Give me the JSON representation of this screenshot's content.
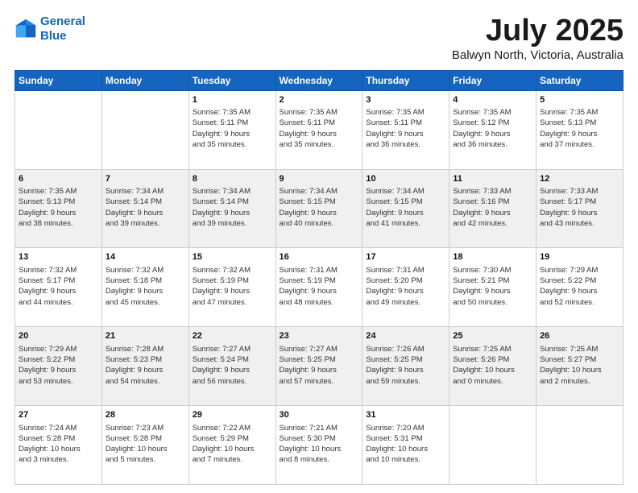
{
  "header": {
    "logo_line1": "General",
    "logo_line2": "Blue",
    "main_title": "July 2025",
    "subtitle": "Balwyn North, Victoria, Australia"
  },
  "calendar": {
    "days_of_week": [
      "Sunday",
      "Monday",
      "Tuesday",
      "Wednesday",
      "Thursday",
      "Friday",
      "Saturday"
    ],
    "weeks": [
      [
        {
          "day": "",
          "content": ""
        },
        {
          "day": "",
          "content": ""
        },
        {
          "day": "1",
          "content": "Sunrise: 7:35 AM\nSunset: 5:11 PM\nDaylight: 9 hours\nand 35 minutes."
        },
        {
          "day": "2",
          "content": "Sunrise: 7:35 AM\nSunset: 5:11 PM\nDaylight: 9 hours\nand 35 minutes."
        },
        {
          "day": "3",
          "content": "Sunrise: 7:35 AM\nSunset: 5:11 PM\nDaylight: 9 hours\nand 36 minutes."
        },
        {
          "day": "4",
          "content": "Sunrise: 7:35 AM\nSunset: 5:12 PM\nDaylight: 9 hours\nand 36 minutes."
        },
        {
          "day": "5",
          "content": "Sunrise: 7:35 AM\nSunset: 5:13 PM\nDaylight: 9 hours\nand 37 minutes."
        }
      ],
      [
        {
          "day": "6",
          "content": "Sunrise: 7:35 AM\nSunset: 5:13 PM\nDaylight: 9 hours\nand 38 minutes."
        },
        {
          "day": "7",
          "content": "Sunrise: 7:34 AM\nSunset: 5:14 PM\nDaylight: 9 hours\nand 39 minutes."
        },
        {
          "day": "8",
          "content": "Sunrise: 7:34 AM\nSunset: 5:14 PM\nDaylight: 9 hours\nand 39 minutes."
        },
        {
          "day": "9",
          "content": "Sunrise: 7:34 AM\nSunset: 5:15 PM\nDaylight: 9 hours\nand 40 minutes."
        },
        {
          "day": "10",
          "content": "Sunrise: 7:34 AM\nSunset: 5:15 PM\nDaylight: 9 hours\nand 41 minutes."
        },
        {
          "day": "11",
          "content": "Sunrise: 7:33 AM\nSunset: 5:16 PM\nDaylight: 9 hours\nand 42 minutes."
        },
        {
          "day": "12",
          "content": "Sunrise: 7:33 AM\nSunset: 5:17 PM\nDaylight: 9 hours\nand 43 minutes."
        }
      ],
      [
        {
          "day": "13",
          "content": "Sunrise: 7:32 AM\nSunset: 5:17 PM\nDaylight: 9 hours\nand 44 minutes."
        },
        {
          "day": "14",
          "content": "Sunrise: 7:32 AM\nSunset: 5:18 PM\nDaylight: 9 hours\nand 45 minutes."
        },
        {
          "day": "15",
          "content": "Sunrise: 7:32 AM\nSunset: 5:19 PM\nDaylight: 9 hours\nand 47 minutes."
        },
        {
          "day": "16",
          "content": "Sunrise: 7:31 AM\nSunset: 5:19 PM\nDaylight: 9 hours\nand 48 minutes."
        },
        {
          "day": "17",
          "content": "Sunrise: 7:31 AM\nSunset: 5:20 PM\nDaylight: 9 hours\nand 49 minutes."
        },
        {
          "day": "18",
          "content": "Sunrise: 7:30 AM\nSunset: 5:21 PM\nDaylight: 9 hours\nand 50 minutes."
        },
        {
          "day": "19",
          "content": "Sunrise: 7:29 AM\nSunset: 5:22 PM\nDaylight: 9 hours\nand 52 minutes."
        }
      ],
      [
        {
          "day": "20",
          "content": "Sunrise: 7:29 AM\nSunset: 5:22 PM\nDaylight: 9 hours\nand 53 minutes."
        },
        {
          "day": "21",
          "content": "Sunrise: 7:28 AM\nSunset: 5:23 PM\nDaylight: 9 hours\nand 54 minutes."
        },
        {
          "day": "22",
          "content": "Sunrise: 7:27 AM\nSunset: 5:24 PM\nDaylight: 9 hours\nand 56 minutes."
        },
        {
          "day": "23",
          "content": "Sunrise: 7:27 AM\nSunset: 5:25 PM\nDaylight: 9 hours\nand 57 minutes."
        },
        {
          "day": "24",
          "content": "Sunrise: 7:26 AM\nSunset: 5:25 PM\nDaylight: 9 hours\nand 59 minutes."
        },
        {
          "day": "25",
          "content": "Sunrise: 7:25 AM\nSunset: 5:26 PM\nDaylight: 10 hours\nand 0 minutes."
        },
        {
          "day": "26",
          "content": "Sunrise: 7:25 AM\nSunset: 5:27 PM\nDaylight: 10 hours\nand 2 minutes."
        }
      ],
      [
        {
          "day": "27",
          "content": "Sunrise: 7:24 AM\nSunset: 5:28 PM\nDaylight: 10 hours\nand 3 minutes."
        },
        {
          "day": "28",
          "content": "Sunrise: 7:23 AM\nSunset: 5:28 PM\nDaylight: 10 hours\nand 5 minutes."
        },
        {
          "day": "29",
          "content": "Sunrise: 7:22 AM\nSunset: 5:29 PM\nDaylight: 10 hours\nand 7 minutes."
        },
        {
          "day": "30",
          "content": "Sunrise: 7:21 AM\nSunset: 5:30 PM\nDaylight: 10 hours\nand 8 minutes."
        },
        {
          "day": "31",
          "content": "Sunrise: 7:20 AM\nSunset: 5:31 PM\nDaylight: 10 hours\nand 10 minutes."
        },
        {
          "day": "",
          "content": ""
        },
        {
          "day": "",
          "content": ""
        }
      ]
    ]
  }
}
